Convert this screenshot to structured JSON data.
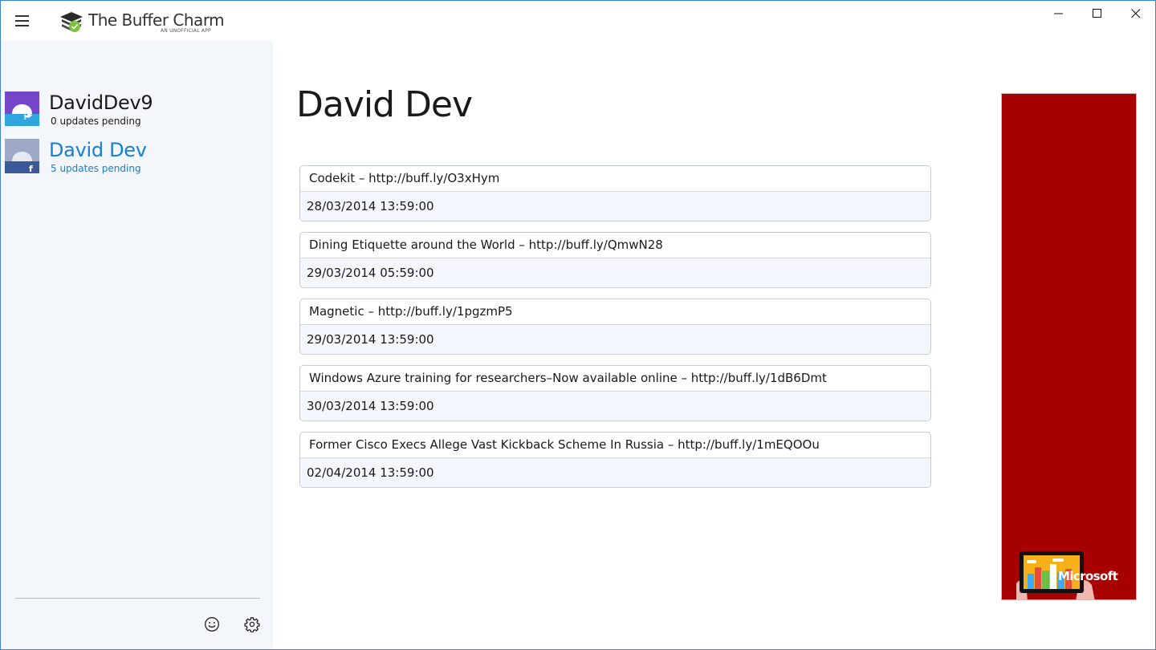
{
  "app": {
    "title": "The Buffer Charm",
    "subtitle": "AN UNOFFICIAL APP"
  },
  "window_controls": [
    "minimize-icon",
    "maximize-icon",
    "close-icon"
  ],
  "sidebar": {
    "accounts": [
      {
        "name": "DavidDev9",
        "pending": "0 updates pending",
        "network": "twitter",
        "active": false
      },
      {
        "name": "David Dev",
        "pending": "5 updates pending",
        "network": "facebook",
        "active": true
      }
    ],
    "footer_icons": [
      "smiley-icon",
      "gear-icon"
    ]
  },
  "main": {
    "title": "David Dev",
    "updates": [
      {
        "text": "Codekit – http://buff.ly/O3xHym",
        "date": "28/03/2014 13:59:00"
      },
      {
        "text": "Dining Etiquette around the World – http://buff.ly/QmwN28",
        "date": "29/03/2014 05:59:00"
      },
      {
        "text": "Magnetic – http://buff.ly/1pgzmP5",
        "date": "29/03/2014 13:59:00"
      },
      {
        "text": "Windows Azure training for researchers–Now available online – http://buff.ly/1dB6Dmt",
        "date": "30/03/2014 13:59:00"
      },
      {
        "text": "Former Cisco Execs Allege Vast Kickback Scheme In Russia – http://buff.ly/1mEQOOu",
        "date": "02/04/2014 13:59:00"
      }
    ]
  },
  "ad": {
    "brand": "Microsoft",
    "background": "#a80000"
  },
  "colors": {
    "accent": "#1a7fd0",
    "twitter": "#1da1f2",
    "facebook": "#3b5998",
    "sidebar_bg": "#f3f6fb"
  }
}
